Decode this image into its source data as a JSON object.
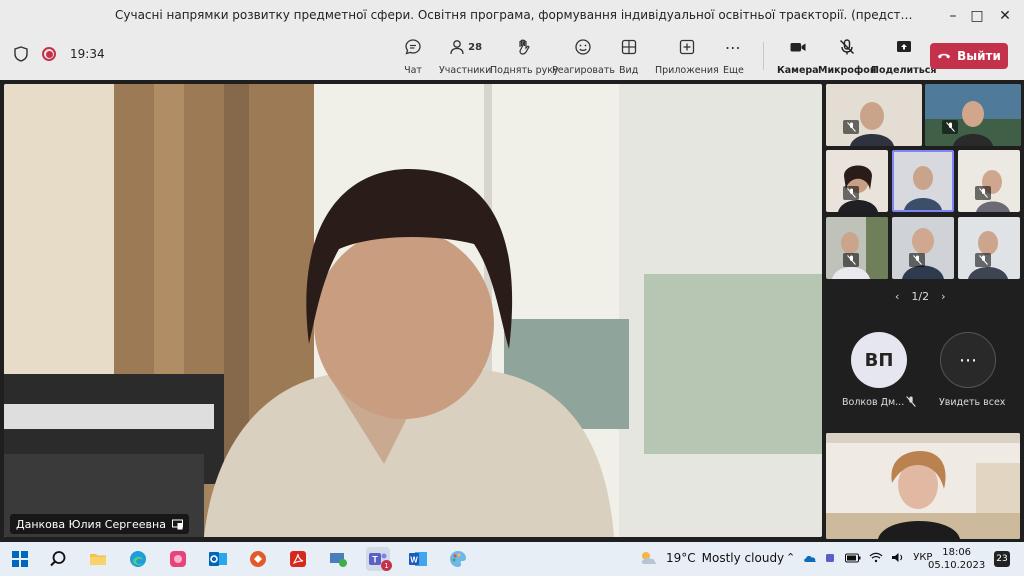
{
  "window": {
    "title": "Сучасні напрямки розвитку предметної сфери. Освітня програма, формування індивідуальної освітньої траєкторії. (представник групи МІ, проф. Поваж..."
  },
  "toolbar": {
    "timer": "19:34",
    "chat_label": "Чат",
    "participants_label": "Участники",
    "participants_count": "28",
    "raise_hand_label": "Поднять руку",
    "react_label": "Реагировать",
    "view_label": "Вид",
    "apps_label": "Приложения",
    "more_label": "Еще",
    "camera_label": "Камера",
    "mic_label": "Микрофон",
    "share_label": "Поделиться",
    "leave_label": "Выйти"
  },
  "main_video": {
    "speaker_name": "Данкова Юлия Сергеевна"
  },
  "gallery": {
    "page_indicator": "1/2",
    "avatar_initials": "ВП",
    "avatar_name": "Волков Дм...",
    "see_all_label": "Увидеть всех"
  },
  "taskbar": {
    "weather_temp": "19°C",
    "weather_desc": "Mostly cloudy",
    "lang": "УКР",
    "time": "18:06",
    "date": "05.10.2023",
    "notification_count": "23",
    "teams_badge": "1"
  },
  "colors": {
    "leave_button": "#c4314b",
    "toolbar_bg": "#ebebeb",
    "stage_bg": "#1f1f1f",
    "taskbar_bg": "#e8eef5",
    "active_tile_border": "#7f85f5"
  }
}
